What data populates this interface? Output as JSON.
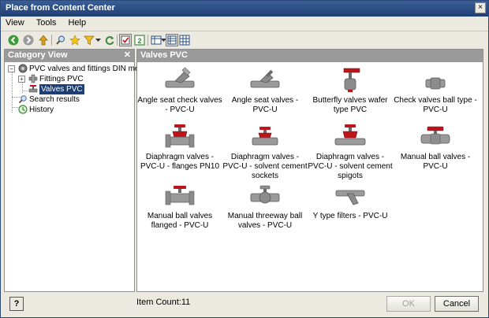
{
  "window": {
    "title": "Place from Content Center",
    "close_glyph": "×"
  },
  "menu": [
    "View",
    "Tools",
    "Help"
  ],
  "toolbar": {
    "icons": [
      "back-icon",
      "forward-icon",
      "up-icon",
      "search-icon",
      "favorites-icon",
      "filter-icon",
      "dropdown-arrow-icon",
      "refresh-icon",
      "select-icon",
      "table-view-icon",
      "view-options-icon",
      "list-view-icon",
      "grid-view-icon"
    ]
  },
  "left_pane": {
    "header": "Category View",
    "close_glyph": "✕",
    "tree": [
      {
        "label": "PVC valves and fittings DIN metric",
        "expander": "−"
      },
      {
        "label": "Fittings PVC",
        "expander": "+"
      },
      {
        "label": "Valves PVC",
        "selected": true
      },
      {
        "label": "Search results"
      },
      {
        "label": "History"
      }
    ]
  },
  "right_pane": {
    "header": "Valves PVC",
    "items": [
      {
        "label": "Angle seat check valves - PVC-U",
        "icon": "angle-seat-check-valve-icon"
      },
      {
        "label": "Angle seat valves - PVC-U",
        "icon": "angle-seat-valve-icon"
      },
      {
        "label": "Butterfly valves wafer type PVC",
        "icon": "butterfly-valve-icon"
      },
      {
        "label": "Check valves ball type - PVC-U",
        "icon": "check-valve-ball-icon"
      },
      {
        "label": "Diaphragm valves - PVC-U - flanges PN10",
        "icon": "diaphragm-valve-flanged-icon"
      },
      {
        "label": "Diaphragm valves - PVC-U - solvent cement sockets",
        "icon": "diaphragm-valve-sockets-icon"
      },
      {
        "label": "Diaphragm valves - PVC-U - solvent cement spigots",
        "icon": "diaphragm-valve-spigots-icon"
      },
      {
        "label": "Manual ball valves - PVC-U",
        "icon": "manual-ball-valve-icon"
      },
      {
        "label": "Manual ball valves flanged - PVC-U",
        "icon": "manual-ball-valve-flanged-icon"
      },
      {
        "label": "Manual threeway ball valves - PVC-U",
        "icon": "threeway-ball-valve-icon"
      },
      {
        "label": "Y type filters - PVC-U",
        "icon": "y-filter-icon"
      }
    ]
  },
  "status": {
    "item_count": "Item Count:11",
    "help_label": "?"
  },
  "buttons": {
    "ok": "OK",
    "cancel": "Cancel"
  },
  "colors": {
    "title_bar": "#1e3f73",
    "valve_body": "#8c8c8c",
    "valve_handle": "#c0141c",
    "selection": "#1e3f73"
  }
}
